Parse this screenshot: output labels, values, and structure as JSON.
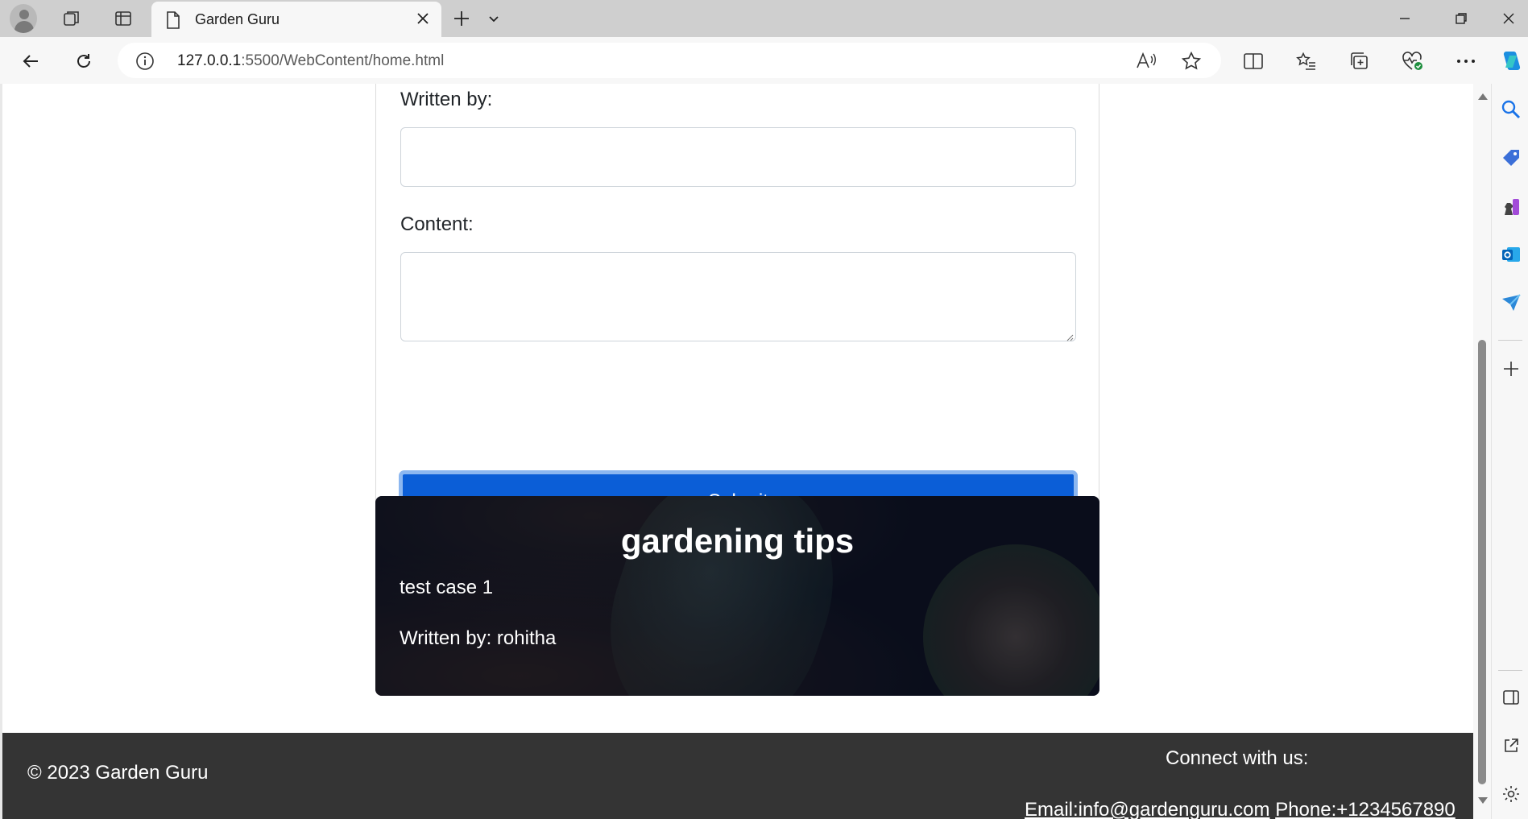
{
  "browser": {
    "tab_title": "Garden Guru",
    "url_host": "127.0.0.1",
    "url_rest": ":5500/WebContent/home.html"
  },
  "form": {
    "written_by_label": "Written by:",
    "content_label": "Content:",
    "submit_label": "Submit",
    "accent_color": "#0b5ed7"
  },
  "tips_card": {
    "title": "gardening tips",
    "content": "test case 1",
    "author": "Written by: rohitha"
  },
  "footer": {
    "copyright": "© 2023 Garden Guru",
    "connect": "Connect with us:",
    "email": "Email:info@gardenguru.com",
    "phone": "Phone:+1234567890"
  }
}
